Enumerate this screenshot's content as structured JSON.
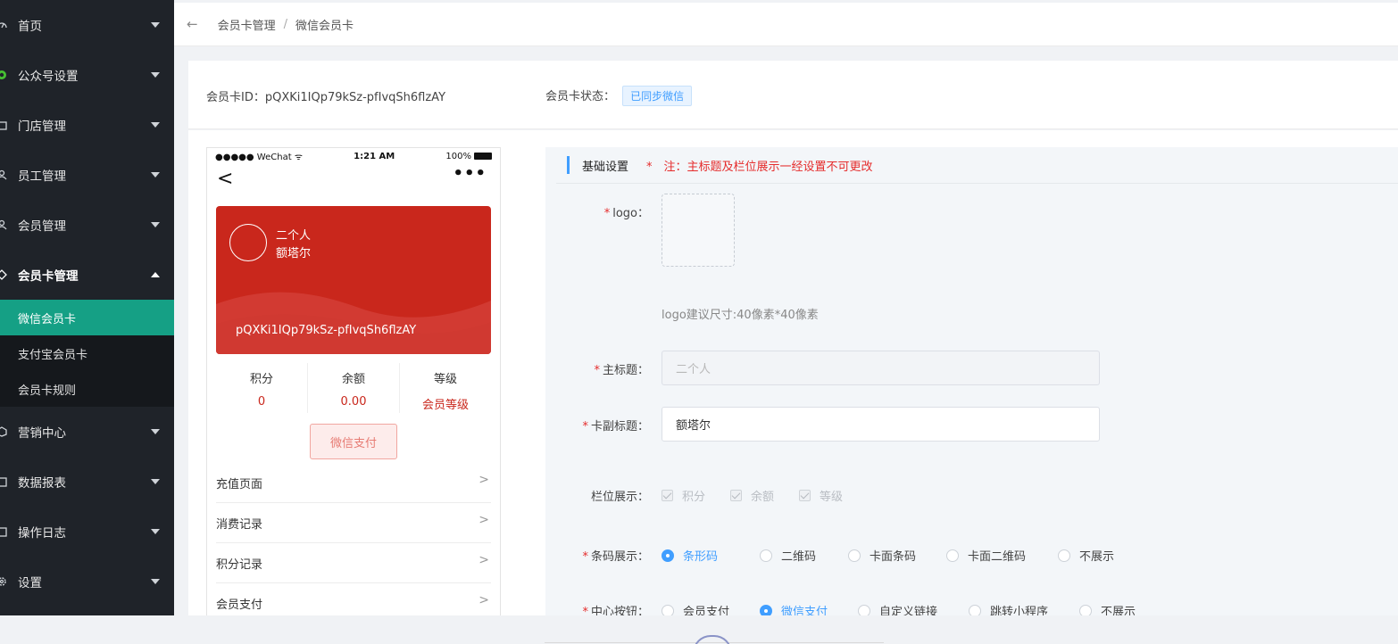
{
  "sidebar": {
    "items": [
      {
        "label": "首页",
        "icon": "dashboard-icon"
      },
      {
        "label": "公众号设置",
        "icon": "wechat-icon"
      },
      {
        "label": "门店管理",
        "icon": "store-icon"
      },
      {
        "label": "员工管理",
        "icon": "staff-icon"
      },
      {
        "label": "会员管理",
        "icon": "member-icon"
      },
      {
        "label": "会员卡管理",
        "icon": "card-icon"
      }
    ],
    "submenu": [
      {
        "label": "微信会员卡"
      },
      {
        "label": "支付宝会员卡"
      },
      {
        "label": "会员卡规则"
      }
    ],
    "items_after": [
      {
        "label": "营销中心",
        "icon": "marketing-icon"
      },
      {
        "label": "数据报表",
        "icon": "report-icon"
      },
      {
        "label": "操作日志",
        "icon": "log-icon"
      },
      {
        "label": "设置",
        "icon": "settings-icon"
      }
    ]
  },
  "breadcrumb": {
    "back": "←",
    "parent": "会员卡管理",
    "separator": "/",
    "current": "微信会员卡"
  },
  "card_info": {
    "id_label": "会员卡ID：pQXKi1IQp79kSz-pfIvqSh6flzAY",
    "status_label": "会员卡状态：",
    "status_value": "已同步微信"
  },
  "phone": {
    "carrier": "●●●●● WeChat",
    "time": "1:21 AM",
    "battery": "100%",
    "back": "<",
    "more": "•••",
    "card_title": "二个人",
    "card_subtitle": "额塔尔",
    "card_code": "pQXKi1IQp79kSz-pfIvqSh6flzAY",
    "card_color": "#c9271c",
    "stats": [
      {
        "label": "积分",
        "value": "0"
      },
      {
        "label": "余额",
        "value": "0.00"
      },
      {
        "label": "等级",
        "value": "会员等级"
      }
    ],
    "pay_button": "微信支付",
    "list": [
      "充值页面",
      "消费记录",
      "积分记录",
      "会员支付"
    ],
    "chevron": ">"
  },
  "settings": {
    "section_title": "基础设置",
    "section_note": "*　注：主标题及栏位展示一经设置不可更改",
    "required_mark": "*",
    "logo_label": "logo：",
    "logo_hint": "logo建议尺寸:40像素*40像素",
    "title_label": "主标题：",
    "title_value": "二个人",
    "subtitle_label": "卡副标题：",
    "subtitle_value": "额塔尔",
    "fields_label": "栏位展示：",
    "fields": [
      "积分",
      "余额",
      "等级"
    ],
    "barcode_label": "条码展示：",
    "barcode_options": [
      "条形码",
      "二维码",
      "卡面条码",
      "卡面二维码",
      "不展示"
    ],
    "barcode_selected": "条形码",
    "center_label": "中心按钮：",
    "center_options": [
      "会员支付",
      "微信支付",
      "自定义链接",
      "跳转小程序",
      "不展示"
    ],
    "center_selected": "微信支付"
  },
  "colors": {
    "sidebar_bg": "#1f2329",
    "active_menu": "#15a085",
    "primary": "#409eff",
    "card_red": "#c9271c",
    "required_red": "#e52c2c"
  }
}
